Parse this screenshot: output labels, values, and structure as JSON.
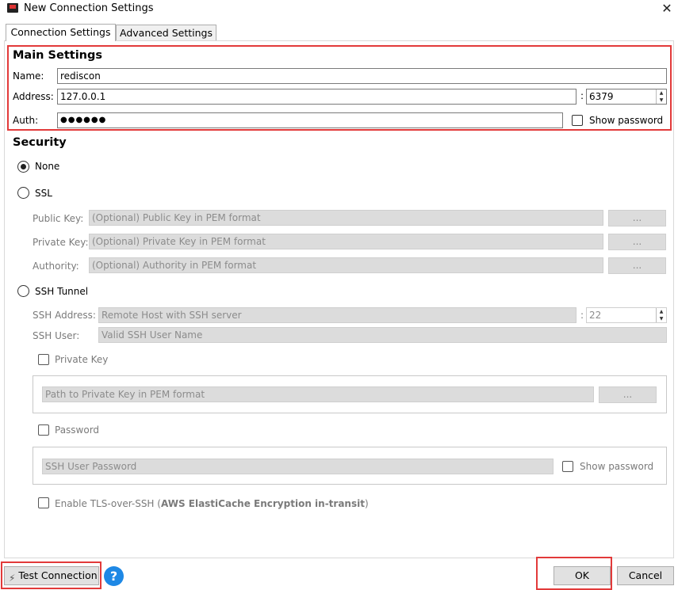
{
  "window": {
    "title": "New Connection Settings",
    "close_glyph": "✕"
  },
  "tabs": [
    {
      "label": "Connection Settings",
      "active": true
    },
    {
      "label": "Advanced Settings",
      "active": false
    }
  ],
  "main": {
    "title": "Main Settings",
    "name_label": "Name:",
    "name_value": "rediscon",
    "address_label": "Address:",
    "address_value": "127.0.0.1",
    "port_sep": ":",
    "port_value": "6379",
    "auth_label": "Auth:",
    "auth_value": "●●●●●●",
    "show_password": "Show password"
  },
  "security": {
    "title": "Security",
    "none_label": "None",
    "ssl_label": "SSL",
    "public_key_label": "Public Key:",
    "public_key_placeholder": "(Optional) Public Key in PEM format",
    "private_key_label": "Private Key:",
    "private_key_placeholder": "(Optional) Private Key in PEM format",
    "authority_label": "Authority:",
    "authority_placeholder": "(Optional) Authority in PEM format",
    "browse": "...",
    "ssh_label": "SSH Tunnel",
    "ssh_address_label": "SSH Address:",
    "ssh_address_placeholder": "Remote Host with SSH server",
    "ssh_port_sep": ":",
    "ssh_port_value": "22",
    "ssh_user_label": "SSH User:",
    "ssh_user_placeholder": "Valid SSH User Name",
    "private_key_check": "Private Key",
    "private_key_path_placeholder": "Path to Private Key in PEM format",
    "password_check": "Password",
    "ssh_password_placeholder": "SSH User Password",
    "show_password": "Show password",
    "tls_prefix": "Enable TLS-over-SSH (",
    "tls_bold": "AWS ElastiCache Encryption in-transit",
    "tls_suffix": ")"
  },
  "footer": {
    "test_connection": "Test Connection",
    "help_glyph": "?",
    "ok": "OK",
    "cancel": "Cancel"
  },
  "colors": {
    "highlight": "#e23a3a",
    "help_blue": "#1e88e5"
  }
}
